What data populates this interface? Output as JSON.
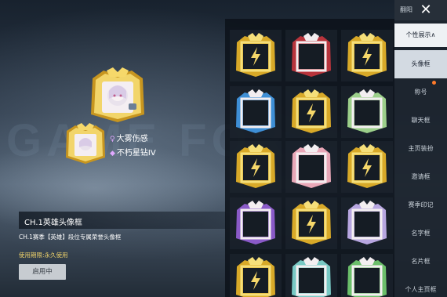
{
  "background_text": "GAME FOR",
  "preview": {
    "player_name": "大雾伤感",
    "player_rank": "不朽星钻IV",
    "gender_icon": "female-icon",
    "rank_icon": "diamond-rank-icon"
  },
  "info": {
    "title": "CH.1英雄头像框",
    "description": "CH.1赛季【英雄】段位专属荣誉头像框",
    "period": "使用期限:永久使用",
    "use_button": "启用中"
  },
  "side": {
    "top_label": "翻阳",
    "close_icon": "close-icon",
    "group_label": "个性展示∧",
    "tabs": [
      {
        "label": "头像框",
        "active": true
      },
      {
        "label": "称号",
        "active": false
      },
      {
        "label": "聊天框",
        "active": false
      },
      {
        "label": "主页装扮",
        "active": false
      },
      {
        "label": "邀请框",
        "active": false
      },
      {
        "label": "赛季印记",
        "active": false
      },
      {
        "label": "名字框",
        "active": false
      },
      {
        "label": "名片框",
        "active": false
      },
      {
        "label": "个人主页框",
        "active": false
      }
    ]
  },
  "frames": [
    {
      "name": "frame-gold-crown",
      "style": "gold"
    },
    {
      "name": "frame-red-ribbon",
      "style": "red"
    },
    {
      "name": "frame-gold-crown-2",
      "style": "gold"
    },
    {
      "name": "frame-blue-ribbon",
      "style": "blue"
    },
    {
      "name": "frame-gold-bolt",
      "style": "gold"
    },
    {
      "name": "frame-flower-garland",
      "style": "floral"
    },
    {
      "name": "frame-gold-bolt-2",
      "style": "gold"
    },
    {
      "name": "frame-pink-bow",
      "style": "pink"
    },
    {
      "name": "frame-gold-bolt-3",
      "style": "gold"
    },
    {
      "name": "frame-purple-ribbon",
      "style": "purple"
    },
    {
      "name": "frame-gold-bolt-4",
      "style": "gold"
    },
    {
      "name": "frame-lilac-garland",
      "style": "lilac"
    },
    {
      "name": "frame-gold-crown-3",
      "style": "gold"
    },
    {
      "name": "frame-teal-cat",
      "style": "teal"
    },
    {
      "name": "frame-green-garland",
      "style": "green"
    }
  ],
  "colors": {
    "gold": "#d8a928",
    "gold_light": "#f5df7a",
    "red": "#b8343c",
    "blue": "#3e8fd6",
    "pink": "#e9a7b7",
    "purple": "#8a5ac8",
    "floral": "#9ccf8a",
    "lilac": "#b7a6e0",
    "teal": "#78c9c4",
    "green": "#6bbf6a",
    "accent_tab": "#ff7a2a"
  }
}
